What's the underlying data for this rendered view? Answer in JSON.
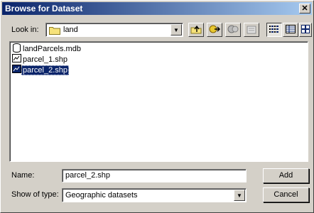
{
  "window": {
    "title": "Browse for Dataset",
    "close_glyph": "✕"
  },
  "lookin": {
    "label": "Look in:",
    "value": "land",
    "icon": "folder-icon"
  },
  "toolbar": {
    "buttons": [
      "up-one-level-icon",
      "connect-folder-icon",
      "disconnect-folder-icon",
      "properties-icon",
      "list-view-icon",
      "details-view-icon",
      "thumbnails-view-icon"
    ]
  },
  "files": [
    {
      "name": "landParcels.mdb",
      "icon": "geodatabase-icon"
    },
    {
      "name": "parcel_1.shp",
      "icon": "shapefile-icon"
    },
    {
      "name": "parcel_2.shp",
      "icon": "shapefile-icon",
      "selected": true
    }
  ],
  "name_field": {
    "label": "Name:",
    "value": "parcel_2.shp"
  },
  "type_field": {
    "label": "Show of type:",
    "value": "Geographic datasets"
  },
  "buttons": {
    "add": "Add",
    "cancel": "Cancel"
  },
  "colors": {
    "titlebar_start": "#0a246a",
    "titlebar_end": "#a6caf0",
    "face": "#d4d0c8",
    "selection": "#0a246a"
  }
}
